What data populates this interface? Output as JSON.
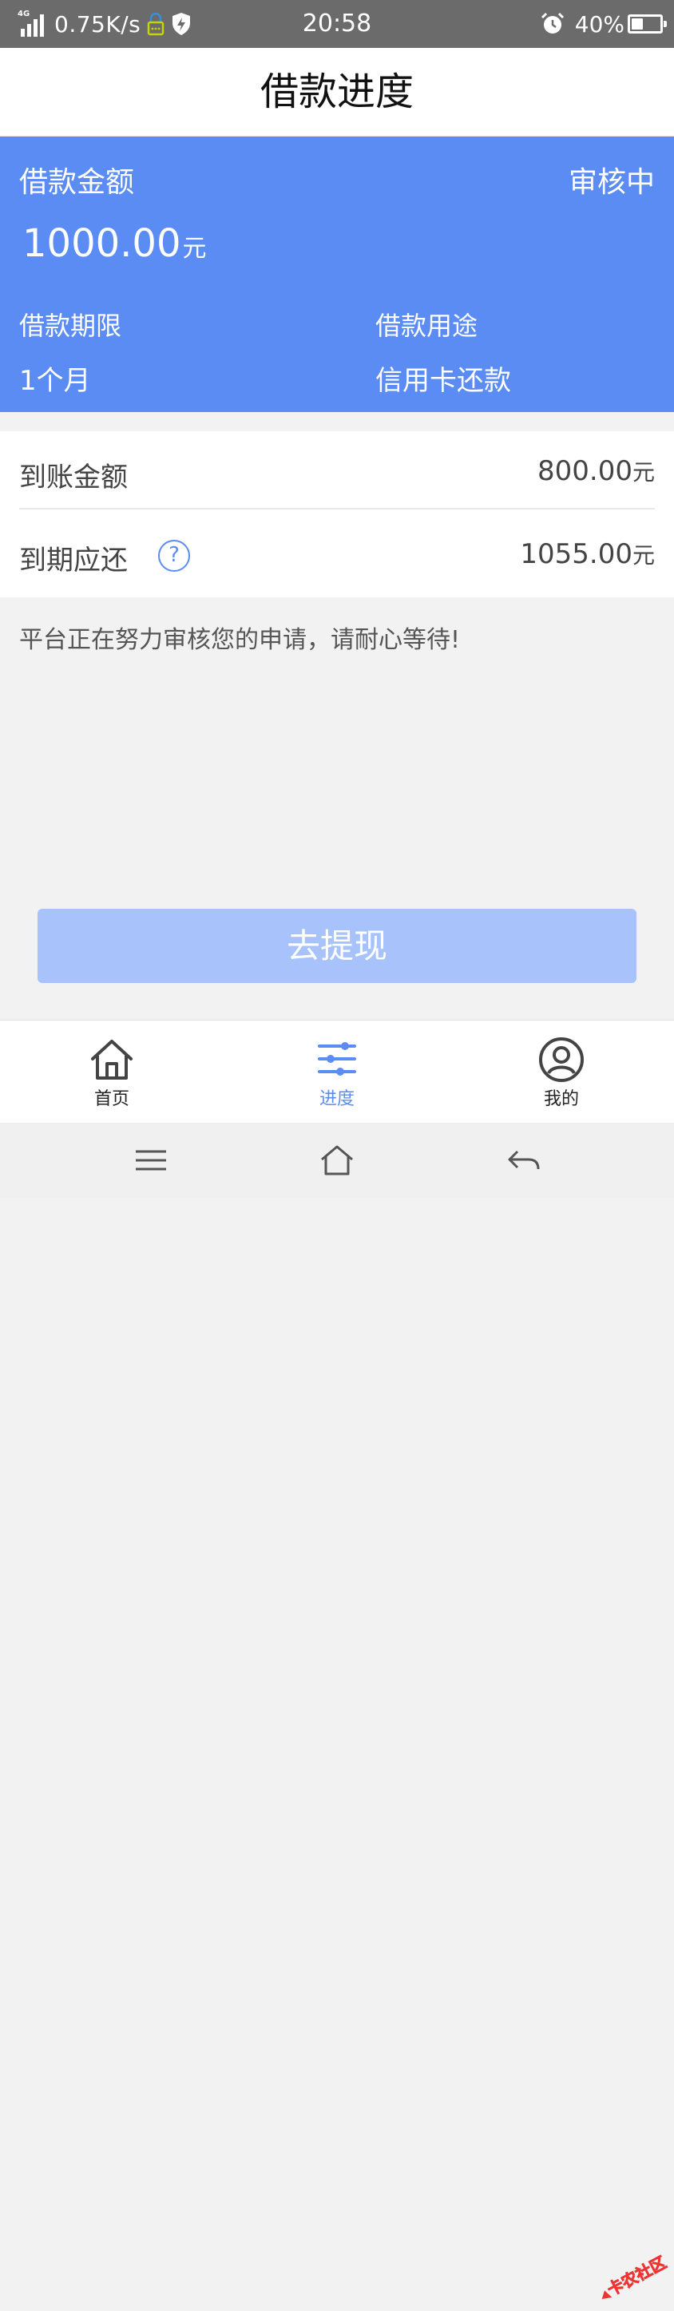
{
  "status_bar": {
    "network": "4G",
    "speed": "0.75K/s",
    "time": "20:58",
    "battery": "40%",
    "battery_level": 0.4
  },
  "header": {
    "title": "借款进度"
  },
  "loan_card": {
    "amount_label": "借款金额",
    "status": "审核中",
    "amount": "1000.00",
    "amount_unit": "元",
    "term_label": "借款期限",
    "term_value": "1个月",
    "purpose_label": "借款用途",
    "purpose_value": "信用卡还款",
    "color": "#5b8cf4"
  },
  "info": {
    "received_label": "到账金额",
    "received_value": "800.00",
    "received_unit": "元",
    "due_label": "到期应还",
    "due_value": "1055.00",
    "due_unit": "元",
    "help_glyph": "?"
  },
  "notice": "平台正在努力审核您的申请，请耐心等待!",
  "withdraw_button": "去提现",
  "bottom_nav": {
    "items": [
      {
        "label": "首页",
        "icon": "home-icon",
        "active": false
      },
      {
        "label": "进度",
        "icon": "sliders-icon",
        "active": true
      },
      {
        "label": "我的",
        "icon": "user-icon",
        "active": false
      }
    ]
  },
  "system_nav": {
    "icons": [
      "menu-icon",
      "home-icon",
      "back-icon"
    ]
  },
  "watermark": "卡农社区"
}
